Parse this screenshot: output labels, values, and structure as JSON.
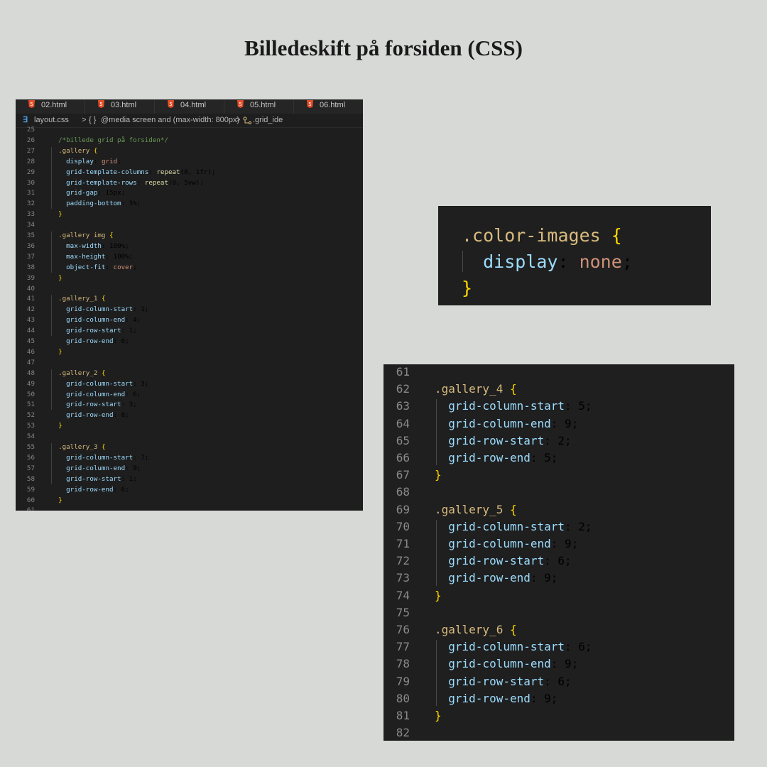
{
  "title": "Billedeskift på forsiden (CSS)",
  "colors": {
    "background": "#d7d9d7",
    "editor_bg": "#1e1e1e",
    "selector": "#d7ba7d",
    "brace": "#ffd700",
    "property": "#9cdcfe",
    "keyword_value": "#ce9178",
    "function": "#dcdcaa",
    "comment": "#6a9955",
    "html_icon": "#e44d26",
    "css_icon": "#4a9fe8"
  },
  "editor": {
    "tabs": [
      {
        "icon": "html-file-icon",
        "label": "02.html"
      },
      {
        "icon": "html-file-icon",
        "label": "03.html"
      },
      {
        "icon": "html-file-icon",
        "label": "04.html"
      },
      {
        "icon": "html-file-icon",
        "label": "05.html"
      },
      {
        "icon": "html-file-icon",
        "label": "06.html"
      }
    ],
    "breadcrumbs": {
      "file_icon": "css-file-icon",
      "file": "layout.css",
      "sep": ">",
      "media_icon": "braces-icon",
      "media_icon_text": "{ }",
      "media": "@media screen and (max-width: 800px)",
      "rule_icon": "selector-icon",
      "rule": ".grid_ide"
    },
    "lines": [
      {
        "n": "25",
        "parts": []
      },
      {
        "n": "26",
        "parts": [
          {
            "t": "  "
          },
          {
            "t": "/*billede grid på forsiden*/",
            "c": "comment"
          }
        ]
      },
      {
        "n": "27",
        "parts": [
          {
            "t": "  "
          },
          {
            "t": ".gallery",
            "c": "sel"
          },
          {
            "t": " "
          },
          {
            "t": "{",
            "c": "brace"
          }
        ]
      },
      {
        "n": "28",
        "parts": [
          {
            "t": "    "
          },
          {
            "t": "display",
            "c": "prop"
          },
          {
            "t": ": "
          },
          {
            "t": "grid",
            "c": "kw"
          },
          {
            "t": ";"
          }
        ]
      },
      {
        "n": "29",
        "parts": [
          {
            "t": "    "
          },
          {
            "t": "grid-template-columns",
            "c": "prop"
          },
          {
            "t": ": "
          },
          {
            "t": "repeat",
            "c": "fn"
          },
          {
            "t": "(8, 1fr);"
          }
        ]
      },
      {
        "n": "30",
        "parts": [
          {
            "t": "    "
          },
          {
            "t": "grid-template-rows",
            "c": "prop"
          },
          {
            "t": ": "
          },
          {
            "t": "repeat",
            "c": "fn"
          },
          {
            "t": "(8, 5vw);"
          }
        ]
      },
      {
        "n": "31",
        "parts": [
          {
            "t": "    "
          },
          {
            "t": "grid-gap",
            "c": "prop"
          },
          {
            "t": ": 15px;"
          }
        ]
      },
      {
        "n": "32",
        "parts": [
          {
            "t": "    "
          },
          {
            "t": "padding-bottom",
            "c": "prop"
          },
          {
            "t": ": 3%;"
          }
        ]
      },
      {
        "n": "33",
        "parts": [
          {
            "t": "  "
          },
          {
            "t": "}",
            "c": "brace"
          }
        ]
      },
      {
        "n": "34",
        "parts": []
      },
      {
        "n": "35",
        "parts": [
          {
            "t": "  "
          },
          {
            "t": ".gallery img",
            "c": "sel"
          },
          {
            "t": " "
          },
          {
            "t": "{",
            "c": "brace"
          }
        ]
      },
      {
        "n": "36",
        "parts": [
          {
            "t": "    "
          },
          {
            "t": "max-width",
            "c": "prop"
          },
          {
            "t": ": 100%;"
          }
        ]
      },
      {
        "n": "37",
        "parts": [
          {
            "t": "    "
          },
          {
            "t": "max-height",
            "c": "prop"
          },
          {
            "t": ": 100%;"
          }
        ]
      },
      {
        "n": "38",
        "parts": [
          {
            "t": "    "
          },
          {
            "t": "object-fit",
            "c": "prop"
          },
          {
            "t": ": "
          },
          {
            "t": "cover",
            "c": "kw"
          },
          {
            "t": ";"
          }
        ]
      },
      {
        "n": "39",
        "parts": [
          {
            "t": "  "
          },
          {
            "t": "}",
            "c": "brace"
          }
        ]
      },
      {
        "n": "40",
        "parts": []
      },
      {
        "n": "41",
        "parts": [
          {
            "t": "  "
          },
          {
            "t": ".gallery_1",
            "c": "sel"
          },
          {
            "t": " "
          },
          {
            "t": "{",
            "c": "brace"
          }
        ]
      },
      {
        "n": "42",
        "parts": [
          {
            "t": "    "
          },
          {
            "t": "grid-column-start",
            "c": "prop"
          },
          {
            "t": ": 1;"
          }
        ]
      },
      {
        "n": "43",
        "parts": [
          {
            "t": "    "
          },
          {
            "t": "grid-column-end",
            "c": "prop"
          },
          {
            "t": ": 4;"
          }
        ]
      },
      {
        "n": "44",
        "parts": [
          {
            "t": "    "
          },
          {
            "t": "grid-row-start",
            "c": "prop"
          },
          {
            "t": ": 1;"
          }
        ]
      },
      {
        "n": "45",
        "parts": [
          {
            "t": "    "
          },
          {
            "t": "grid-row-end",
            "c": "prop"
          },
          {
            "t": ": 6;"
          }
        ]
      },
      {
        "n": "46",
        "parts": [
          {
            "t": "  "
          },
          {
            "t": "}",
            "c": "brace"
          }
        ]
      },
      {
        "n": "47",
        "parts": []
      },
      {
        "n": "48",
        "parts": [
          {
            "t": "  "
          },
          {
            "t": ".gallery_2",
            "c": "sel"
          },
          {
            "t": " "
          },
          {
            "t": "{",
            "c": "brace"
          }
        ]
      },
      {
        "n": "49",
        "parts": [
          {
            "t": "    "
          },
          {
            "t": "grid-column-start",
            "c": "prop"
          },
          {
            "t": ": 3;"
          }
        ]
      },
      {
        "n": "50",
        "parts": [
          {
            "t": "    "
          },
          {
            "t": "grid-column-end",
            "c": "prop"
          },
          {
            "t": ": 6;"
          }
        ]
      },
      {
        "n": "51",
        "parts": [
          {
            "t": "    "
          },
          {
            "t": "grid-row-start",
            "c": "prop"
          },
          {
            "t": ": 3;"
          }
        ]
      },
      {
        "n": "52",
        "parts": [
          {
            "t": "    "
          },
          {
            "t": "grid-row-end",
            "c": "prop"
          },
          {
            "t": ": 8;"
          }
        ]
      },
      {
        "n": "53",
        "parts": [
          {
            "t": "  "
          },
          {
            "t": "}",
            "c": "brace"
          }
        ]
      },
      {
        "n": "54",
        "parts": []
      },
      {
        "n": "55",
        "parts": [
          {
            "t": "  "
          },
          {
            "t": ".gallery_3",
            "c": "sel"
          },
          {
            "t": " "
          },
          {
            "t": "{",
            "c": "brace"
          }
        ]
      },
      {
        "n": "56",
        "parts": [
          {
            "t": "    "
          },
          {
            "t": "grid-column-start",
            "c": "prop"
          },
          {
            "t": ": 7;"
          }
        ]
      },
      {
        "n": "57",
        "parts": [
          {
            "t": "    "
          },
          {
            "t": "grid-column-end",
            "c": "prop"
          },
          {
            "t": ": 9;"
          }
        ]
      },
      {
        "n": "58",
        "parts": [
          {
            "t": "    "
          },
          {
            "t": "grid-row-start",
            "c": "prop"
          },
          {
            "t": ": 1;"
          }
        ]
      },
      {
        "n": "59",
        "parts": [
          {
            "t": "    "
          },
          {
            "t": "grid-row-end",
            "c": "prop"
          },
          {
            "t": ": 6;"
          }
        ]
      },
      {
        "n": "60",
        "parts": [
          {
            "t": "  "
          },
          {
            "t": "}",
            "c": "brace"
          }
        ]
      },
      {
        "n": "61",
        "parts": []
      }
    ]
  },
  "color_snippet": {
    "lines": [
      {
        "parts": [
          {
            "t": ".color-images",
            "c": "sel"
          },
          {
            "t": " "
          },
          {
            "t": "{",
            "c": "brace"
          }
        ]
      },
      {
        "parts": [
          {
            "t": "  "
          },
          {
            "t": "display",
            "c": "prop"
          },
          {
            "t": ": "
          },
          {
            "t": "none",
            "c": "kw"
          },
          {
            "t": ";"
          }
        ]
      },
      {
        "parts": [
          {
            "t": "}",
            "c": "brace"
          }
        ]
      }
    ]
  },
  "gallery_snippet": {
    "lines": [
      {
        "n": "61",
        "parts": []
      },
      {
        "n": "62",
        "parts": [
          {
            "t": ".gallery_4",
            "c": "sel"
          },
          {
            "t": " "
          },
          {
            "t": "{",
            "c": "brace"
          }
        ]
      },
      {
        "n": "63",
        "parts": [
          {
            "t": "  "
          },
          {
            "t": "grid-column-start",
            "c": "prop"
          },
          {
            "t": ": 5;"
          }
        ]
      },
      {
        "n": "64",
        "parts": [
          {
            "t": "  "
          },
          {
            "t": "grid-column-end",
            "c": "prop"
          },
          {
            "t": ": 9;"
          }
        ]
      },
      {
        "n": "65",
        "parts": [
          {
            "t": "  "
          },
          {
            "t": "grid-row-start",
            "c": "prop"
          },
          {
            "t": ": 2;"
          }
        ]
      },
      {
        "n": "66",
        "parts": [
          {
            "t": "  "
          },
          {
            "t": "grid-row-end",
            "c": "prop"
          },
          {
            "t": ": 5;"
          }
        ]
      },
      {
        "n": "67",
        "parts": [
          {
            "t": "}",
            "c": "brace"
          }
        ]
      },
      {
        "n": "68",
        "parts": []
      },
      {
        "n": "69",
        "parts": [
          {
            "t": ".gallery_5",
            "c": "sel"
          },
          {
            "t": " "
          },
          {
            "t": "{",
            "c": "brace"
          }
        ]
      },
      {
        "n": "70",
        "parts": [
          {
            "t": "  "
          },
          {
            "t": "grid-column-start",
            "c": "prop"
          },
          {
            "t": ": 2;"
          }
        ]
      },
      {
        "n": "71",
        "parts": [
          {
            "t": "  "
          },
          {
            "t": "grid-column-end",
            "c": "prop"
          },
          {
            "t": ": 9;"
          }
        ]
      },
      {
        "n": "72",
        "parts": [
          {
            "t": "  "
          },
          {
            "t": "grid-row-start",
            "c": "prop"
          },
          {
            "t": ": 6;"
          }
        ]
      },
      {
        "n": "73",
        "parts": [
          {
            "t": "  "
          },
          {
            "t": "grid-row-end",
            "c": "prop"
          },
          {
            "t": ": 9;"
          }
        ]
      },
      {
        "n": "74",
        "parts": [
          {
            "t": "}",
            "c": "brace"
          }
        ]
      },
      {
        "n": "75",
        "parts": []
      },
      {
        "n": "76",
        "parts": [
          {
            "t": ".gallery_6",
            "c": "sel"
          },
          {
            "t": " "
          },
          {
            "t": "{",
            "c": "brace"
          }
        ]
      },
      {
        "n": "77",
        "parts": [
          {
            "t": "  "
          },
          {
            "t": "grid-column-start",
            "c": "prop"
          },
          {
            "t": ": 6;"
          }
        ]
      },
      {
        "n": "78",
        "parts": [
          {
            "t": "  "
          },
          {
            "t": "grid-column-end",
            "c": "prop"
          },
          {
            "t": ": 9;"
          }
        ]
      },
      {
        "n": "79",
        "parts": [
          {
            "t": "  "
          },
          {
            "t": "grid-row-start",
            "c": "prop"
          },
          {
            "t": ": 6;"
          }
        ]
      },
      {
        "n": "80",
        "parts": [
          {
            "t": "  "
          },
          {
            "t": "grid-row-end",
            "c": "prop"
          },
          {
            "t": ": 9;"
          }
        ]
      },
      {
        "n": "81",
        "parts": [
          {
            "t": "}",
            "c": "brace"
          }
        ]
      },
      {
        "n": "82",
        "parts": []
      }
    ]
  }
}
